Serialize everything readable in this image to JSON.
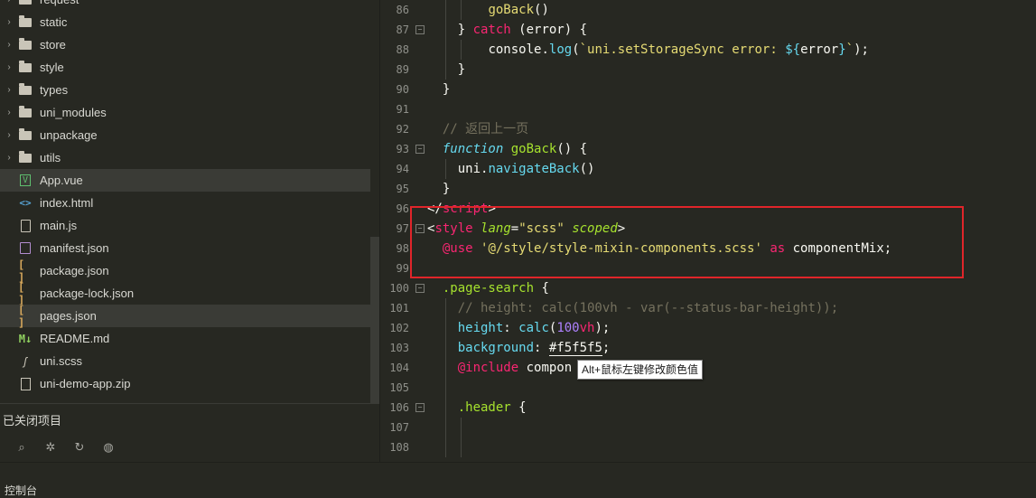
{
  "sidebar": {
    "items": [
      {
        "label": "request",
        "type": "folder",
        "chevron": "›"
      },
      {
        "label": "static",
        "type": "folder",
        "chevron": "›"
      },
      {
        "label": "store",
        "type": "folder",
        "chevron": "›"
      },
      {
        "label": "style",
        "type": "folder",
        "chevron": "›"
      },
      {
        "label": "types",
        "type": "folder",
        "chevron": "›"
      },
      {
        "label": "uni_modules",
        "type": "folder",
        "chevron": "›"
      },
      {
        "label": "unpackage",
        "type": "folder",
        "chevron": "›"
      },
      {
        "label": "utils",
        "type": "folder",
        "chevron": "›"
      },
      {
        "label": "App.vue",
        "type": "vue",
        "icon_text": "V",
        "active": true
      },
      {
        "label": "index.html",
        "type": "html",
        "icon_text": "<>"
      },
      {
        "label": "main.js",
        "type": "js"
      },
      {
        "label": "manifest.json",
        "type": "json"
      },
      {
        "label": "package.json",
        "type": "brackets",
        "icon_text": "[ ]"
      },
      {
        "label": "package-lock.json",
        "type": "brackets",
        "icon_text": "[ ]"
      },
      {
        "label": "pages.json",
        "type": "brackets",
        "icon_text": "[ ]",
        "active": true
      },
      {
        "label": "README.md",
        "type": "md",
        "icon_text": "M↓"
      },
      {
        "label": "uni.scss",
        "type": "scss",
        "icon_text": "ʃ"
      },
      {
        "label": "uni-demo-app.zip",
        "type": "zip"
      }
    ],
    "closed_projects_title": "已关闭项目",
    "tools": [
      {
        "name": "binoculars-icon",
        "glyph": "⌕"
      },
      {
        "name": "bug-icon",
        "glyph": "✲"
      },
      {
        "name": "refresh-bug-icon",
        "glyph": "↻"
      },
      {
        "name": "globe-icon",
        "glyph": "◍"
      }
    ]
  },
  "editor": {
    "lines": [
      {
        "num": "86",
        "fold": false,
        "guides": [
          1,
          2
        ],
        "tokens": [
          {
            "t": "goBack",
            "c": "t-fn"
          },
          {
            "t": "()",
            "c": "t-ident"
          }
        ]
      },
      {
        "num": "87",
        "fold": true,
        "guides": [
          1
        ],
        "tokens": [
          {
            "t": "} ",
            "c": "t-ident"
          },
          {
            "t": "catch",
            "c": "t-kw"
          },
          {
            "t": " (error) {",
            "c": "t-ident"
          }
        ]
      },
      {
        "num": "88",
        "fold": false,
        "guides": [
          1,
          2
        ],
        "tokens": [
          {
            "t": "console",
            "c": "t-ident"
          },
          {
            "t": ".",
            "c": "t-ident"
          },
          {
            "t": "log",
            "c": "t-meth"
          },
          {
            "t": "(",
            "c": "t-ident"
          },
          {
            "t": "`uni.setStorageSync error: ",
            "c": "t-str"
          },
          {
            "t": "${",
            "c": "t-tpl"
          },
          {
            "t": "error",
            "c": "t-ident"
          },
          {
            "t": "}",
            "c": "t-tpl"
          },
          {
            "t": "`",
            "c": "t-str"
          },
          {
            "t": ");",
            "c": "t-ident"
          }
        ]
      },
      {
        "num": "89",
        "fold": false,
        "guides": [
          1
        ],
        "tokens": [
          {
            "t": "}",
            "c": "t-ident"
          }
        ]
      },
      {
        "num": "90",
        "fold": false,
        "guides": [],
        "tokens": [
          {
            "t": "}",
            "c": "t-ident"
          }
        ]
      },
      {
        "num": "91",
        "fold": false,
        "guides": [],
        "tokens": []
      },
      {
        "num": "92",
        "fold": false,
        "guides": [],
        "tokens": [
          {
            "t": "// 返回上一页",
            "c": "t-comment"
          }
        ]
      },
      {
        "num": "93",
        "fold": true,
        "guides": [],
        "tokens": [
          {
            "t": "function",
            "c": "t-func-kw"
          },
          {
            "t": " ",
            "c": "t-ident"
          },
          {
            "t": "goBack",
            "c": "t-fname"
          },
          {
            "t": "() {",
            "c": "t-ident"
          }
        ]
      },
      {
        "num": "94",
        "fold": false,
        "guides": [
          1
        ],
        "tokens": [
          {
            "t": "uni",
            "c": "t-ident"
          },
          {
            "t": ".",
            "c": "t-ident"
          },
          {
            "t": "navigateBack",
            "c": "t-meth"
          },
          {
            "t": "()",
            "c": "t-ident"
          }
        ]
      },
      {
        "num": "95",
        "fold": false,
        "guides": [],
        "tokens": [
          {
            "t": "}",
            "c": "t-ident"
          }
        ]
      },
      {
        "num": "96",
        "fold": false,
        "guides": [],
        "tokens": [
          {
            "t": "</",
            "c": "t-ident"
          },
          {
            "t": "script",
            "c": "t-tag"
          },
          {
            "t": ">",
            "c": "t-ident"
          }
        ]
      },
      {
        "num": "97",
        "fold": true,
        "guides": [],
        "tokens": [
          {
            "t": "<",
            "c": "t-ident"
          },
          {
            "t": "style",
            "c": "t-tag"
          },
          {
            "t": " ",
            "c": "t-ident"
          },
          {
            "t": "lang",
            "c": "t-attr"
          },
          {
            "t": "=",
            "c": "t-ident"
          },
          {
            "t": "\"scss\"",
            "c": "t-attrval"
          },
          {
            "t": " ",
            "c": "t-ident"
          },
          {
            "t": "scoped",
            "c": "t-attr"
          },
          {
            "t": ">",
            "c": "t-ident"
          }
        ]
      },
      {
        "num": "98",
        "fold": false,
        "guides": [],
        "tokens": [
          {
            "t": "@use",
            "c": "t-at"
          },
          {
            "t": " ",
            "c": "t-ident"
          },
          {
            "t": "'@/style/style-mixin-components.scss'",
            "c": "t-str"
          },
          {
            "t": " ",
            "c": "t-ident"
          },
          {
            "t": "as",
            "c": "t-kw"
          },
          {
            "t": " componentMix;",
            "c": "t-ident"
          }
        ]
      },
      {
        "num": "99",
        "fold": false,
        "guides": [],
        "tokens": []
      },
      {
        "num": "100",
        "fold": true,
        "guides": [],
        "tokens": [
          {
            "t": ".page-search",
            "c": "t-sel"
          },
          {
            "t": " {",
            "c": "t-ident"
          }
        ]
      },
      {
        "num": "101",
        "fold": false,
        "guides": [
          1
        ],
        "tokens": [
          {
            "t": "// height: calc(100vh - var(--status-bar-height));",
            "c": "t-comment"
          }
        ]
      },
      {
        "num": "102",
        "fold": false,
        "guides": [
          1
        ],
        "tokens": [
          {
            "t": "height",
            "c": "t-prop"
          },
          {
            "t": ": ",
            "c": "t-ident"
          },
          {
            "t": "calc",
            "c": "t-meth"
          },
          {
            "t": "(",
            "c": "t-ident"
          },
          {
            "t": "100",
            "c": "t-num"
          },
          {
            "t": "vh",
            "c": "t-unit"
          },
          {
            "t": ");",
            "c": "t-ident"
          }
        ]
      },
      {
        "num": "103",
        "fold": false,
        "guides": [
          1
        ],
        "tokens": [
          {
            "t": "background",
            "c": "t-prop"
          },
          {
            "t": ": ",
            "c": "t-ident"
          },
          {
            "t": "#f5f5f5",
            "c": "t-color"
          },
          {
            "t": ";",
            "c": "t-ident"
          }
        ]
      },
      {
        "num": "104",
        "fold": false,
        "guides": [
          1
        ],
        "tokens": [
          {
            "t": "@include",
            "c": "t-at"
          },
          {
            "t": " compon",
            "c": "t-ident"
          },
          {
            "t": "              ",
            "c": "t-ident"
          },
          {
            "t": ");",
            "c": "t-ident"
          }
        ]
      },
      {
        "num": "105",
        "fold": false,
        "guides": [
          1
        ],
        "tokens": []
      },
      {
        "num": "106",
        "fold": true,
        "guides": [
          1
        ],
        "tokens": [
          {
            "t": ".header",
            "c": "t-sel"
          },
          {
            "t": " {",
            "c": "t-ident"
          }
        ]
      },
      {
        "num": "107",
        "fold": false,
        "guides": [
          1,
          2
        ],
        "tokens": []
      },
      {
        "num": "108",
        "fold": false,
        "guides": [
          1,
          2
        ],
        "tokens": []
      }
    ],
    "tooltip": "Alt+鼠标左键修改颜色值",
    "highlight_color": "#e0252a"
  },
  "bottom": {
    "label": "控制台"
  },
  "colors": {
    "background": "#272822",
    "active_row": "#3a3b36",
    "keyword": "#f92672",
    "string": "#e6db74",
    "function": "#a6e22e",
    "builtin": "#66d9ef",
    "number": "#ae81ff",
    "comment": "#75715e"
  }
}
